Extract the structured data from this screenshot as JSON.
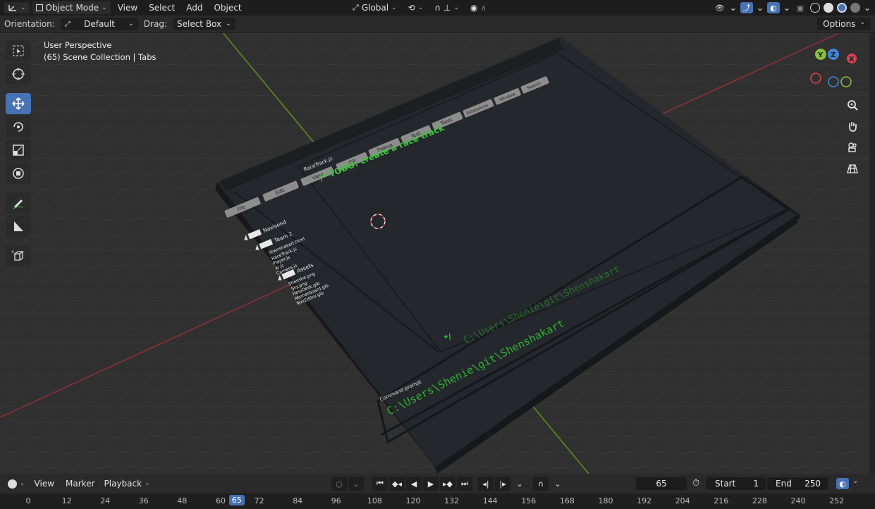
{
  "header": {
    "mode": "Object Mode",
    "menus": [
      "View",
      "Select",
      "Add",
      "Object"
    ],
    "orientation_global": "Global"
  },
  "toolsettings": {
    "orientation_label": "Orientation:",
    "orientation_value": "Default",
    "drag_label": "Drag:",
    "drag_value": "Select Box",
    "options": "Options"
  },
  "viewport": {
    "perspective": "User Perspective",
    "collection": "(65) Scene Collection | Tabs"
  },
  "gizmo": {
    "y": "Y",
    "z": "Z",
    "x": "X"
  },
  "model": {
    "tabs": [
      "File",
      "Edit",
      "View",
      "Git",
      "Debug",
      "Test",
      "Tools",
      "Extensions",
      "Window",
      "Search"
    ],
    "file_tab": "RaceTrack.js",
    "code_comment": "/* TODO: create a race track",
    "code_end": "*/",
    "explorer": [
      "Navisend",
      "Team 2",
      "Shenshakart.html",
      "RaceTrack.js",
      "Player.js",
      "AI.js",
      "Camera.js",
      "Assets",
      "Shenshe.png",
      "Sky.png",
      "HelpDesk.glb",
      "Motherboard.glb",
      "TextEditor.glb"
    ],
    "prompt_label": "Command prompt",
    "prompt_path": "C:\\Users\\Shenie\\git\\Shenshakart"
  },
  "timeline": {
    "menus": [
      "View",
      "Marker",
      "Playback"
    ],
    "current_frame": "65",
    "start_label": "Start",
    "start": "1",
    "end_label": "End",
    "end": "250",
    "ticks": [
      "0",
      "12",
      "24",
      "36",
      "48",
      "60",
      "72",
      "84",
      "96",
      "108",
      "120",
      "132",
      "144",
      "156",
      "168",
      "180",
      "192",
      "204",
      "216",
      "228",
      "240",
      "252"
    ]
  },
  "colors": {
    "accent": "#4772b3",
    "code_green": "#39c53a",
    "background": "#303030"
  }
}
